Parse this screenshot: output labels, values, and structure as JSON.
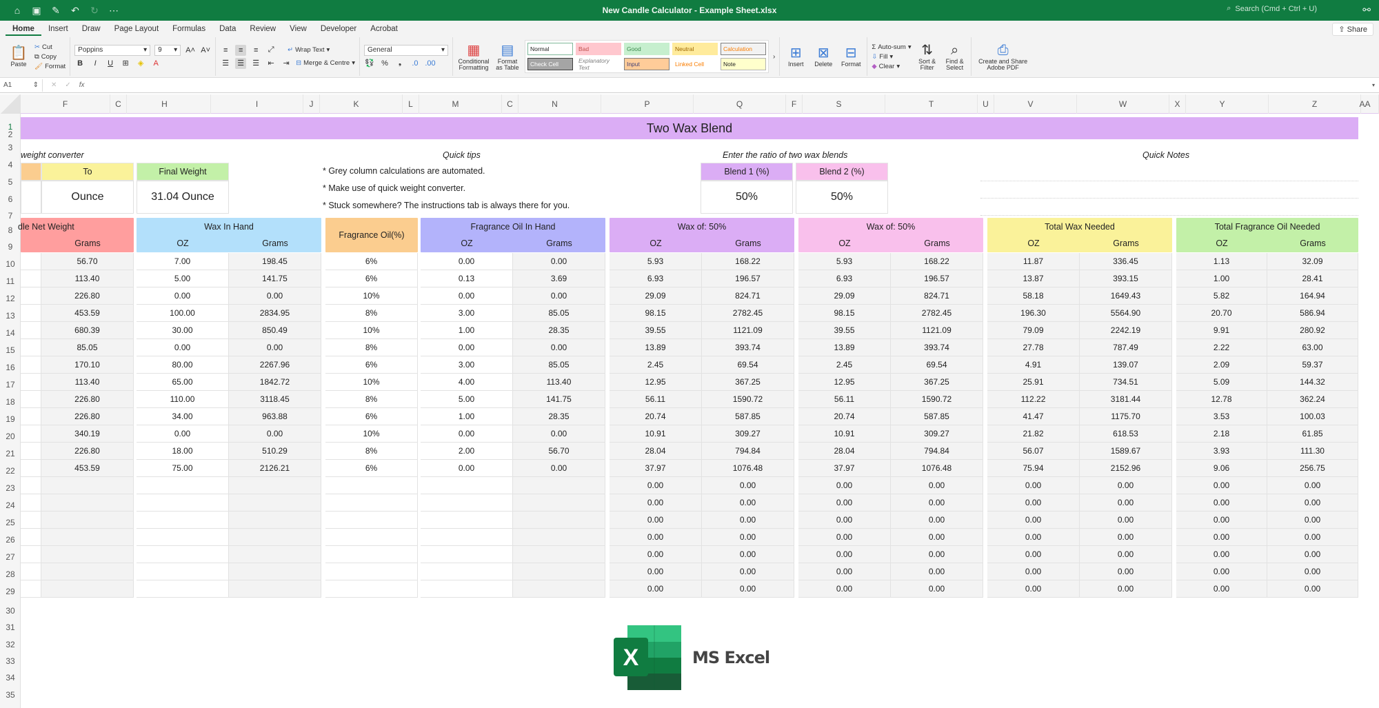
{
  "window": {
    "title": "New Candle Calculator - Example Sheet.xlsx",
    "search_placeholder": "Search (Cmd + Ctrl + U)",
    "quick_access": [
      "home-icon",
      "save-icon",
      "save-as-icon",
      "undo-icon",
      "redo-icon",
      "more-icon"
    ]
  },
  "menu": {
    "tabs": [
      "Home",
      "Insert",
      "Draw",
      "Page Layout",
      "Formulas",
      "Data",
      "Review",
      "View",
      "Developer",
      "Acrobat"
    ],
    "active": "Home",
    "share_label": "Share"
  },
  "ribbon": {
    "paste": "Paste",
    "cut": "Cut",
    "copy": "Copy",
    "format_painter": "Format",
    "font_name": "Poppins",
    "font_size": "9",
    "wrap_text": "Wrap Text",
    "merge_centre": "Merge & Centre",
    "number_format": "General",
    "conditional_formatting": "Conditional Formatting",
    "format_as_table": "Format as Table",
    "styles": [
      {
        "label": "Normal",
        "bg": "#ffffff",
        "fg": "#222222",
        "border": "#7fb89a"
      },
      {
        "label": "Bad",
        "bg": "#ffc7ce",
        "fg": "#c0504d",
        "border": "#ffc7ce"
      },
      {
        "label": "Good",
        "bg": "#c6efce",
        "fg": "#3d8b4f",
        "border": "#c6efce"
      },
      {
        "label": "Neutral",
        "bg": "#ffeb9c",
        "fg": "#9c6500",
        "border": "#ffeb9c"
      },
      {
        "label": "Calculation",
        "bg": "#f2f2f2",
        "fg": "#fa7d00",
        "border": "#7f7f7f"
      },
      {
        "label": "Check Cell",
        "bg": "#a5a5a5",
        "fg": "#ffffff",
        "border": "#3f3f3f"
      },
      {
        "label": "Explanatory Text",
        "bg": "#ffffff",
        "fg": "#7f7f7f",
        "border": "#ffffff"
      },
      {
        "label": "Input",
        "bg": "#ffcc99",
        "fg": "#3f3f76",
        "border": "#7f7f7f"
      },
      {
        "label": "Linked Cell",
        "bg": "#ffffff",
        "fg": "#fa7d00",
        "border": "#ffffff"
      },
      {
        "label": "Note",
        "bg": "#ffffcc",
        "fg": "#222222",
        "border": "#b2b2b2"
      }
    ],
    "insert": "Insert",
    "delete": "Delete",
    "format": "Format",
    "autosum": "Auto-sum",
    "fill": "Fill",
    "clear": "Clear",
    "sort_filter": "Sort & Filter",
    "find_select": "Find & Select",
    "adobe_pdf": "Create and Share Adobe PDF"
  },
  "formula_bar": {
    "name_box": "A1",
    "formula": ""
  },
  "columns": [
    "F",
    "C",
    "H",
    "I",
    "J",
    "K",
    "L",
    "M",
    "C",
    "N",
    "P",
    "Q",
    "F",
    "S",
    "T",
    "U",
    "V",
    "W",
    "X",
    "Y",
    "Z",
    "AA"
  ],
  "rows": [
    "1",
    "2",
    "3",
    "4",
    "5",
    "6",
    "7",
    "8",
    "9",
    "10",
    "11",
    "12",
    "13",
    "14",
    "15",
    "16",
    "17",
    "18",
    "19",
    "20",
    "21",
    "22",
    "23",
    "24",
    "25",
    "26",
    "27",
    "28",
    "29",
    "30",
    "31",
    "32",
    "33",
    "34",
    "35"
  ],
  "sheet": {
    "banner": "Two Wax Blend",
    "converter": {
      "title": "weight converter",
      "to_label": "To",
      "to_value": "Ounce",
      "final_label": "Final Weight",
      "final_value": "31.04 Ounce"
    },
    "tips": {
      "title": "Quick tips",
      "items": [
        "* Grey column calculations are automated.",
        "* Make use of quick weight converter.",
        "* Stuck somewhere? The instructions tab is always there for you."
      ]
    },
    "ratio": {
      "title": "Enter the ratio of two wax blends",
      "blend1_label": "Blend 1 (%)",
      "blend1_value": "50%",
      "blend2_label": "Blend 2 (%)",
      "blend2_value": "50%"
    },
    "notes": {
      "title": "Quick Notes"
    },
    "table": {
      "groups": [
        {
          "title": "dle Net Weight",
          "subs": [
            "Grams"
          ],
          "color": "#ff9e9e"
        },
        {
          "title": "Wax In Hand",
          "subs": [
            "OZ",
            "Grams"
          ],
          "color": "#b3e0fb"
        },
        {
          "title": "Fragrance Oil(%)",
          "subs": [],
          "color": "#fbcd8f"
        },
        {
          "title": "Fragrance Oil In Hand",
          "subs": [
            "OZ",
            "Grams"
          ],
          "color": "#b3b3fb"
        },
        {
          "title": "Wax of: 50%",
          "subs": [
            "OZ",
            "Grams"
          ],
          "color": "#dbadf5"
        },
        {
          "title": "Wax of: 50%",
          "subs": [
            "OZ",
            "Grams"
          ],
          "color": "#f9c0ec"
        },
        {
          "title": "Total Wax Needed",
          "subs": [
            "OZ",
            "Grams"
          ],
          "color": "#faf29a"
        },
        {
          "title": "Total Fragrance Oil Needed",
          "subs": [
            "OZ",
            "Grams"
          ],
          "color": "#c3f0a8"
        }
      ],
      "rows": [
        [
          "56.70",
          "7.00",
          "198.45",
          "6%",
          "0.00",
          "0.00",
          "5.93",
          "168.22",
          "5.93",
          "168.22",
          "11.87",
          "336.45",
          "1.13",
          "32.09"
        ],
        [
          "113.40",
          "5.00",
          "141.75",
          "6%",
          "0.13",
          "3.69",
          "6.93",
          "196.57",
          "6.93",
          "196.57",
          "13.87",
          "393.15",
          "1.00",
          "28.41"
        ],
        [
          "226.80",
          "0.00",
          "0.00",
          "10%",
          "0.00",
          "0.00",
          "29.09",
          "824.71",
          "29.09",
          "824.71",
          "58.18",
          "1649.43",
          "5.82",
          "164.94"
        ],
        [
          "453.59",
          "100.00",
          "2834.95",
          "8%",
          "3.00",
          "85.05",
          "98.15",
          "2782.45",
          "98.15",
          "2782.45",
          "196.30",
          "5564.90",
          "20.70",
          "586.94"
        ],
        [
          "680.39",
          "30.00",
          "850.49",
          "10%",
          "1.00",
          "28.35",
          "39.55",
          "1121.09",
          "39.55",
          "1121.09",
          "79.09",
          "2242.19",
          "9.91",
          "280.92"
        ],
        [
          "85.05",
          "0.00",
          "0.00",
          "8%",
          "0.00",
          "0.00",
          "13.89",
          "393.74",
          "13.89",
          "393.74",
          "27.78",
          "787.49",
          "2.22",
          "63.00"
        ],
        [
          "170.10",
          "80.00",
          "2267.96",
          "6%",
          "3.00",
          "85.05",
          "2.45",
          "69.54",
          "2.45",
          "69.54",
          "4.91",
          "139.07",
          "2.09",
          "59.37"
        ],
        [
          "113.40",
          "65.00",
          "1842.72",
          "10%",
          "4.00",
          "113.40",
          "12.95",
          "367.25",
          "12.95",
          "367.25",
          "25.91",
          "734.51",
          "5.09",
          "144.32"
        ],
        [
          "226.80",
          "110.00",
          "3118.45",
          "8%",
          "5.00",
          "141.75",
          "56.11",
          "1590.72",
          "56.11",
          "1590.72",
          "112.22",
          "3181.44",
          "12.78",
          "362.24"
        ],
        [
          "226.80",
          "34.00",
          "963.88",
          "6%",
          "1.00",
          "28.35",
          "20.74",
          "587.85",
          "20.74",
          "587.85",
          "41.47",
          "1175.70",
          "3.53",
          "100.03"
        ],
        [
          "340.19",
          "0.00",
          "0.00",
          "10%",
          "0.00",
          "0.00",
          "10.91",
          "309.27",
          "10.91",
          "309.27",
          "21.82",
          "618.53",
          "2.18",
          "61.85"
        ],
        [
          "226.80",
          "18.00",
          "510.29",
          "8%",
          "2.00",
          "56.70",
          "28.04",
          "794.84",
          "28.04",
          "794.84",
          "56.07",
          "1589.67",
          "3.93",
          "111.30"
        ],
        [
          "453.59",
          "75.00",
          "2126.21",
          "6%",
          "0.00",
          "0.00",
          "37.97",
          "1076.48",
          "37.97",
          "1076.48",
          "75.94",
          "2152.96",
          "9.06",
          "256.75"
        ],
        [
          "",
          "",
          "",
          "",
          "",
          "",
          "0.00",
          "0.00",
          "0.00",
          "0.00",
          "0.00",
          "0.00",
          "0.00",
          "0.00"
        ],
        [
          "",
          "",
          "",
          "",
          "",
          "",
          "0.00",
          "0.00",
          "0.00",
          "0.00",
          "0.00",
          "0.00",
          "0.00",
          "0.00"
        ],
        [
          "",
          "",
          "",
          "",
          "",
          "",
          "0.00",
          "0.00",
          "0.00",
          "0.00",
          "0.00",
          "0.00",
          "0.00",
          "0.00"
        ],
        [
          "",
          "",
          "",
          "",
          "",
          "",
          "0.00",
          "0.00",
          "0.00",
          "0.00",
          "0.00",
          "0.00",
          "0.00",
          "0.00"
        ],
        [
          "",
          "",
          "",
          "",
          "",
          "",
          "0.00",
          "0.00",
          "0.00",
          "0.00",
          "0.00",
          "0.00",
          "0.00",
          "0.00"
        ],
        [
          "",
          "",
          "",
          "",
          "",
          "",
          "0.00",
          "0.00",
          "0.00",
          "0.00",
          "0.00",
          "0.00",
          "0.00",
          "0.00"
        ],
        [
          "",
          "",
          "",
          "",
          "",
          "",
          "0.00",
          "0.00",
          "0.00",
          "0.00",
          "0.00",
          "0.00",
          "0.00",
          "0.00"
        ]
      ]
    },
    "logo_text": "MS Excel"
  }
}
